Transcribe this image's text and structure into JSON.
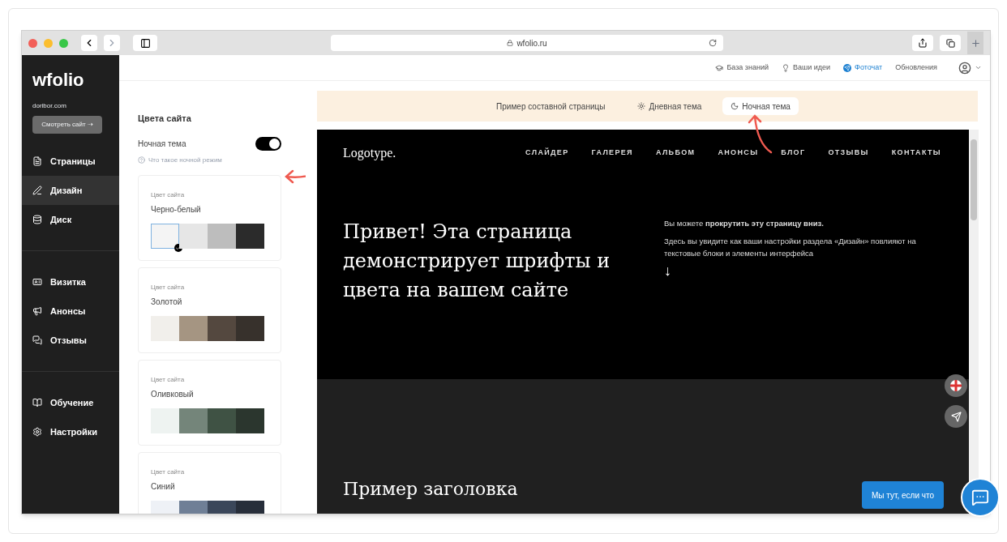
{
  "browser": {
    "url": "wfolio.ru"
  },
  "sidebar": {
    "logo": "wfolio",
    "domain": "doribor.com",
    "view_button": "Смотреть сайт ⇢",
    "groups": [
      [
        {
          "label": "Страницы",
          "selected": false
        },
        {
          "label": "Дизайн",
          "selected": true
        },
        {
          "label": "Диск",
          "selected": false
        }
      ],
      [
        {
          "label": "Визитка",
          "selected": false
        },
        {
          "label": "Анонсы",
          "selected": false
        },
        {
          "label": "Отзывы",
          "selected": false
        }
      ],
      [
        {
          "label": "Обучение",
          "selected": false
        },
        {
          "label": "Настройки",
          "selected": false
        }
      ]
    ]
  },
  "header": {
    "links": [
      {
        "label": "База знаний",
        "highlight": false
      },
      {
        "label": "Ваши идеи",
        "highlight": false
      },
      {
        "label": "Фоточат",
        "highlight": true
      },
      {
        "label": "Обновления",
        "highlight": false
      }
    ]
  },
  "settings": {
    "title": "Цвета сайта",
    "night_toggle": {
      "label": "Ночная тема",
      "on": true
    },
    "help": "Что такое ночной режим",
    "palettes": [
      {
        "caption": "Цвет сайта",
        "name": "Черно-белый",
        "selected": true,
        "swatches": [
          {
            "color": "#f4f4f4"
          },
          {
            "color": "#e6e6e6"
          },
          {
            "color": "#bdbdbd"
          },
          {
            "color": "#2b2b2b"
          }
        ]
      },
      {
        "caption": "Цвет сайта",
        "name": "Золотой",
        "selected": false,
        "swatches": [
          {
            "color": "#f1efeb"
          },
          {
            "color": "#a59582"
          },
          {
            "color": "#54483f"
          },
          {
            "color": "#37312c"
          }
        ]
      },
      {
        "caption": "Цвет сайта",
        "name": "Оливковый",
        "selected": false,
        "swatches": [
          {
            "color": "#eef3f1"
          },
          {
            "color": "#74857a"
          },
          {
            "color": "#3f5244"
          },
          {
            "color": "#2b362e"
          }
        ]
      },
      {
        "caption": "Цвет сайта",
        "name": "Синий",
        "selected": false,
        "swatches": [
          {
            "color": "#eef1f6"
          },
          {
            "color": "#6f7f96"
          },
          {
            "color": "#3b475a"
          },
          {
            "color": "#272e3a"
          }
        ]
      }
    ]
  },
  "preview": {
    "caption": "Пример составной страницы",
    "themes": [
      {
        "label": "Дневная тема",
        "selected": false
      },
      {
        "label": "Ночная тема",
        "selected": true
      }
    ],
    "logo": "Logotype.",
    "nav": [
      "СЛАЙДЕР",
      "ГАЛЕРЕЯ",
      "АЛЬБОМ",
      "АНОНСЫ",
      "БЛОГ",
      "ОТЗЫВЫ",
      "КОНТАКТЫ"
    ],
    "hero_heading": "Привет! Эта страница демонстрирует шрифты и цвета на вашем сайте",
    "hero_text": [
      "Вы можете **прокрутить эту страницу вниз.**",
      "Здесь вы увидите как ваши настройки раздела «Дизайн» повлияют на текстовые блоки и элементы интерфейса"
    ],
    "hero_arrow": "↓",
    "section_heading": "Пример заголовка",
    "chat_label": "Мы тут, если что"
  }
}
